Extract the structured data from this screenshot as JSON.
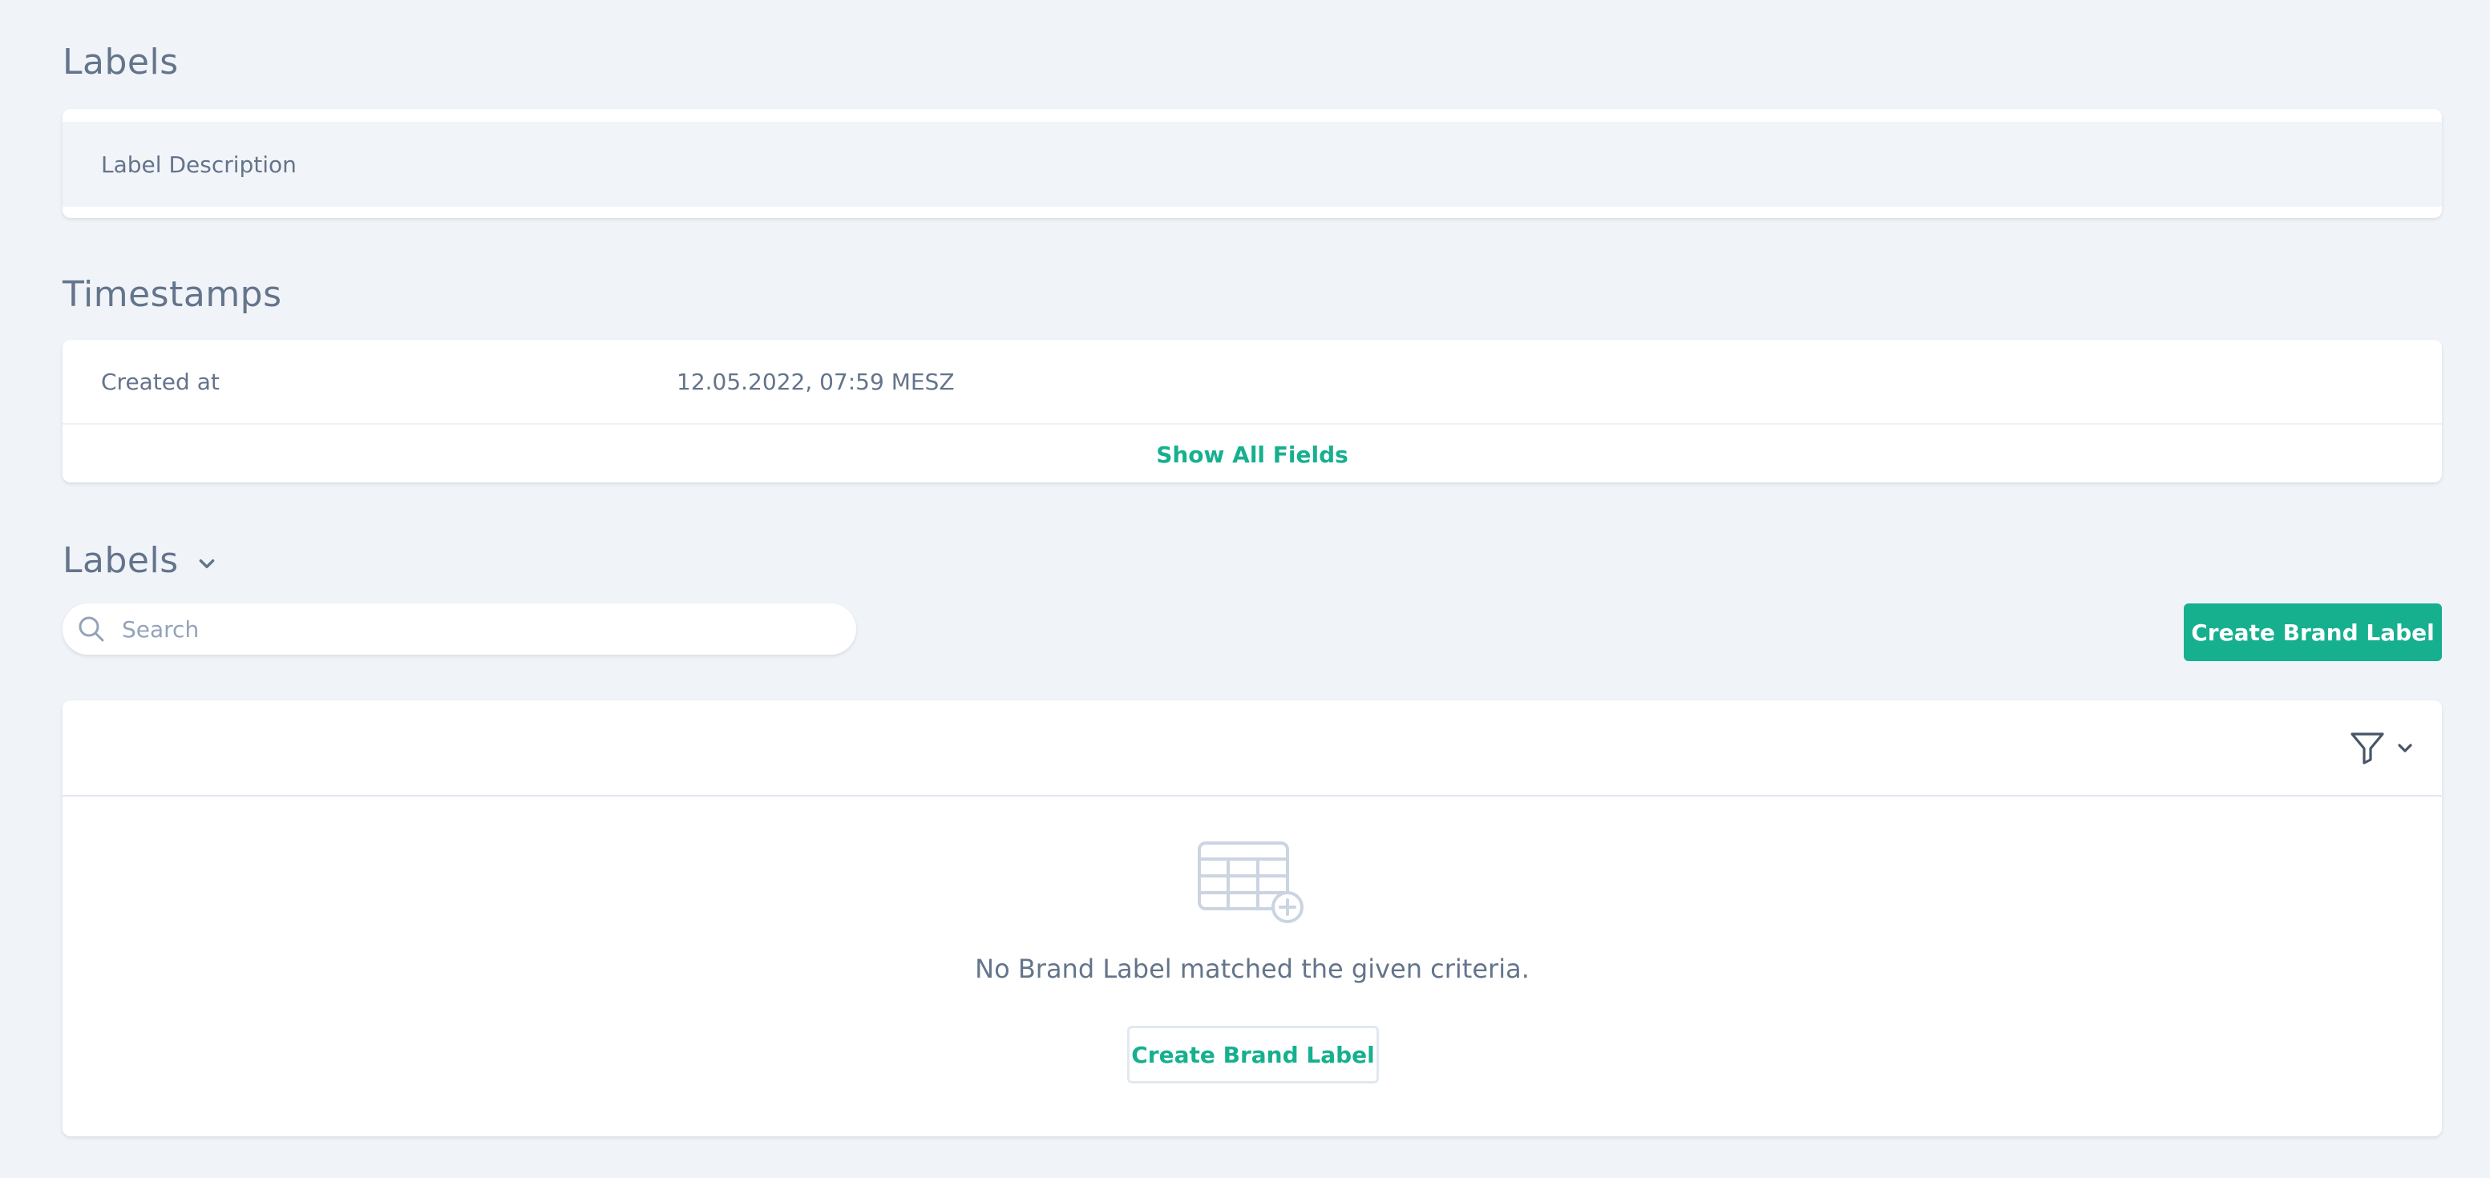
{
  "sections": {
    "labels": {
      "title": "Labels",
      "field_label": "Label Description"
    },
    "timestamps": {
      "title": "Timestamps",
      "created_at_label": "Created at",
      "created_at_value": "12.05.2022, 07:59 MESZ",
      "show_all": "Show All Fields"
    },
    "brand_labels": {
      "title": "Labels",
      "search_placeholder": "Search",
      "create_button": "Create Brand Label",
      "empty_message": "No Brand Label matched the given criteria.",
      "empty_create_button": "Create Brand Label"
    }
  },
  "icons": {
    "search": "search-icon",
    "funnel": "filter-icon",
    "chevron": "chevron-down-icon",
    "empty_table": "table-add-icon"
  },
  "colors": {
    "accent": "#16b08f",
    "text": "#64748b",
    "background": "#f0f4f9"
  }
}
